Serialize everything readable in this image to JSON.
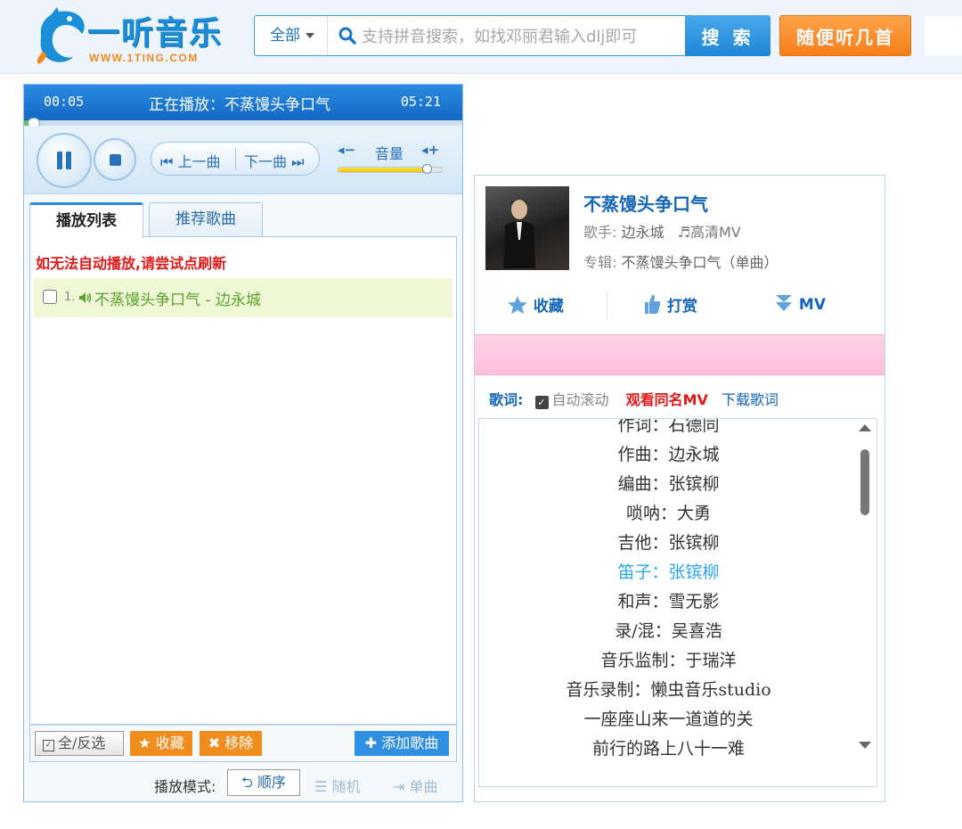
{
  "header": {
    "logo_title": "一听音乐",
    "logo_url": "WWW.1TING.COM",
    "search": {
      "scope": "全部",
      "placeholder": "支持拼音搜索，如找邓丽君输入dlj即可",
      "button": "搜 索"
    },
    "random_button": "随便听几首"
  },
  "player": {
    "current_time": "00:05",
    "total_time": "05:21",
    "now_playing": "正在播放：不蒸馒头争口气",
    "progress": 0.016,
    "prev_label": "上一曲",
    "next_label": "下一曲",
    "volume_label": "音量",
    "volume_down": "◂−",
    "volume_up": "◂+",
    "volume": 0.85,
    "tabs": [
      "播放列表",
      "推荐歌曲"
    ],
    "warning": "如无法自动播放,请尝试点刷新",
    "playlist": [
      {
        "num": "1.",
        "title": "不蒸馒头争口气 - 边永城"
      }
    ],
    "footer": {
      "select_all": "全/反选",
      "favorite": "★ 收藏",
      "remove": "✖ 移除",
      "add_song": "✚ 添加歌曲"
    },
    "mode": {
      "label": "播放模式:",
      "sequential": "顺序",
      "random": "随机",
      "single": "单曲"
    }
  },
  "song": {
    "title": "不蒸馒头争口气",
    "singer_label": "歌手:",
    "singer": "边永城",
    "hd_mv": "♬高清MV",
    "album_label": "专辑:",
    "album": "不蒸馒头争口气（单曲）",
    "actions": {
      "favorite": "收藏",
      "tip": "打赏",
      "mv": "MV"
    },
    "lyrics_label": "歌词:",
    "auto_scroll": "自动滚动",
    "watch_mv": "观看同名MV",
    "download_lyrics": "下载歌词",
    "lyrics": [
      "作词：石德同",
      "作曲：边永城",
      "编曲：张镔柳",
      "唢呐：大勇",
      "吉他：张镔柳",
      "笛子：张镔柳",
      "和声：雪无影",
      "录/混：吴喜浩",
      "音乐监制：于瑞洋",
      "音乐录制：懒虫音乐studio",
      "一座座山来一道道的关",
      "前行的路上八十一难"
    ],
    "current_lyric_index": 5
  }
}
